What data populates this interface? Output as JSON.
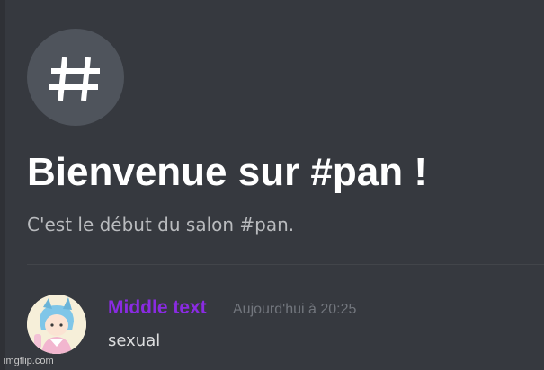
{
  "channel": {
    "icon": "hash-icon",
    "welcome_title": "Bienvenue sur #pan !",
    "welcome_subtitle": "C'est le début du salon #pan."
  },
  "message": {
    "author": "Middle text",
    "author_color": "#8a2be2",
    "timestamp": "Aujourd'hui à 20:25",
    "content": "sexual",
    "avatar": "avatar-icon"
  },
  "watermark": "imgflip.com",
  "colors": {
    "background": "#36393f",
    "title": "#ffffff",
    "subtitle": "#b9bbbe",
    "timestamp": "#72767d",
    "message_text": "#dcddde",
    "icon_circle": "#4f545c"
  }
}
